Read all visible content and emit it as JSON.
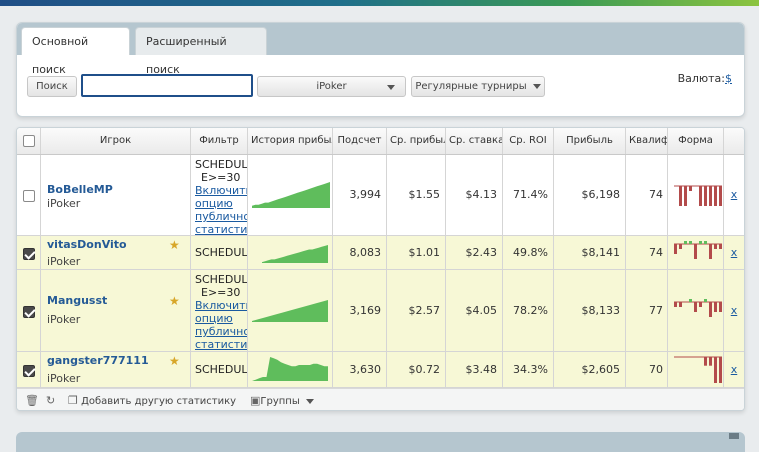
{
  "search": {
    "tabs": [
      {
        "label": "Основной поиск",
        "active": true
      },
      {
        "label": "Расширенный поиск",
        "active": false
      }
    ],
    "search_button": "Поиск",
    "search_value": "",
    "network": "iPoker",
    "tournament_type": "Регулярные турниры",
    "currency_label": "Валюта:",
    "currency_value": "$"
  },
  "table": {
    "headers": {
      "player": "Игрок",
      "filter": "Фильтр",
      "history": "История прибыли",
      "count": "Подсчет",
      "avg_profit": "Ср. прибыль",
      "avg_stake": "Ср. ставка",
      "avg_roi": "Ср. ROI",
      "profit": "Прибыль",
      "qualification": "Квалиф",
      "form": "Форма"
    },
    "rows": [
      {
        "checked": false,
        "starred": false,
        "name": "BoBelleMP",
        "network": "iPoker",
        "filter_lines": [
          "SCHEDUL",
          "E>=30"
        ],
        "filter_link": [
          "Включить",
          "опцию",
          "публично",
          "статисти"
        ],
        "count": "3,994",
        "avg_profit": "$1.55",
        "avg_stake": "$4.13",
        "avg_roi": "71.4%",
        "profit": "$6,198",
        "qualification": "74",
        "history": [
          2,
          3,
          3,
          4,
          5,
          5,
          6,
          7,
          8,
          9,
          10,
          11,
          12,
          13,
          14,
          15,
          16,
          17,
          18,
          19,
          20,
          21,
          22,
          23,
          24
        ],
        "form": [
          0,
          -8,
          -8,
          -2,
          0,
          -8,
          -8,
          -8,
          -8,
          -8
        ],
        "remove": "x"
      },
      {
        "checked": true,
        "starred": true,
        "name": "vitasDonVito",
        "network": "iPoker",
        "filter_lines": [
          "SCHEDUL"
        ],
        "filter_link": [],
        "count": "8,083",
        "avg_profit": "$1.01",
        "avg_stake": "$2.43",
        "avg_roi": "49.8%",
        "profit": "$8,141",
        "qualification": "74",
        "history": [
          1,
          2,
          3,
          4,
          4,
          5,
          6,
          7,
          8,
          9,
          10,
          11,
          12,
          13,
          14,
          15,
          15,
          16,
          17,
          18,
          19,
          20
        ],
        "form": [
          -2,
          -1,
          2,
          1,
          -3,
          2,
          4,
          -3,
          -1,
          -1
        ],
        "remove": "x"
      },
      {
        "checked": true,
        "starred": true,
        "name": "Mangusst",
        "network": "iPoker",
        "filter_lines": [
          "SCHEDUL",
          "E>=30"
        ],
        "filter_link": [
          "Включить",
          "опцию",
          "публично",
          "статисти"
        ],
        "count": "3,169",
        "avg_profit": "$2.57",
        "avg_stake": "$4.05",
        "avg_roi": "78.2%",
        "profit": "$8,133",
        "qualification": "77",
        "history": [
          1,
          2,
          3,
          4,
          5,
          6,
          7,
          8,
          9,
          10,
          11,
          12,
          13,
          14,
          15,
          16,
          17,
          18,
          19,
          20,
          21,
          22
        ],
        "form": [
          -1,
          -1,
          0,
          3,
          -2,
          -1,
          4,
          -3,
          -2,
          -2
        ],
        "remove": "x"
      },
      {
        "checked": true,
        "starred": true,
        "name": "gangster777111",
        "network": "iPoker",
        "filter_lines": [
          "SCHEDUL"
        ],
        "filter_link": [],
        "count": "3,630",
        "avg_profit": "$0.72",
        "avg_stake": "$3.48",
        "avg_roi": "34.3%",
        "profit": "$2,605",
        "qualification": "70",
        "history": [
          0,
          1,
          2,
          3,
          3,
          18,
          17,
          16,
          14,
          13,
          12,
          11,
          11,
          12,
          12,
          12,
          12,
          13,
          13,
          12,
          11,
          11
        ],
        "form": [
          0,
          0,
          0,
          0,
          0,
          0,
          -2,
          -2,
          -6,
          -6
        ],
        "remove": "x"
      }
    ]
  },
  "toolbar": {
    "add_stats": "Добавить другую статистику",
    "groups": "Группы"
  },
  "colors": {
    "history_green": "#5fbd5c",
    "form_red": "#b34b4b",
    "form_green": "#5fbd5c",
    "selected_row": "#f7f8d6",
    "link": "#1a5aa0"
  }
}
